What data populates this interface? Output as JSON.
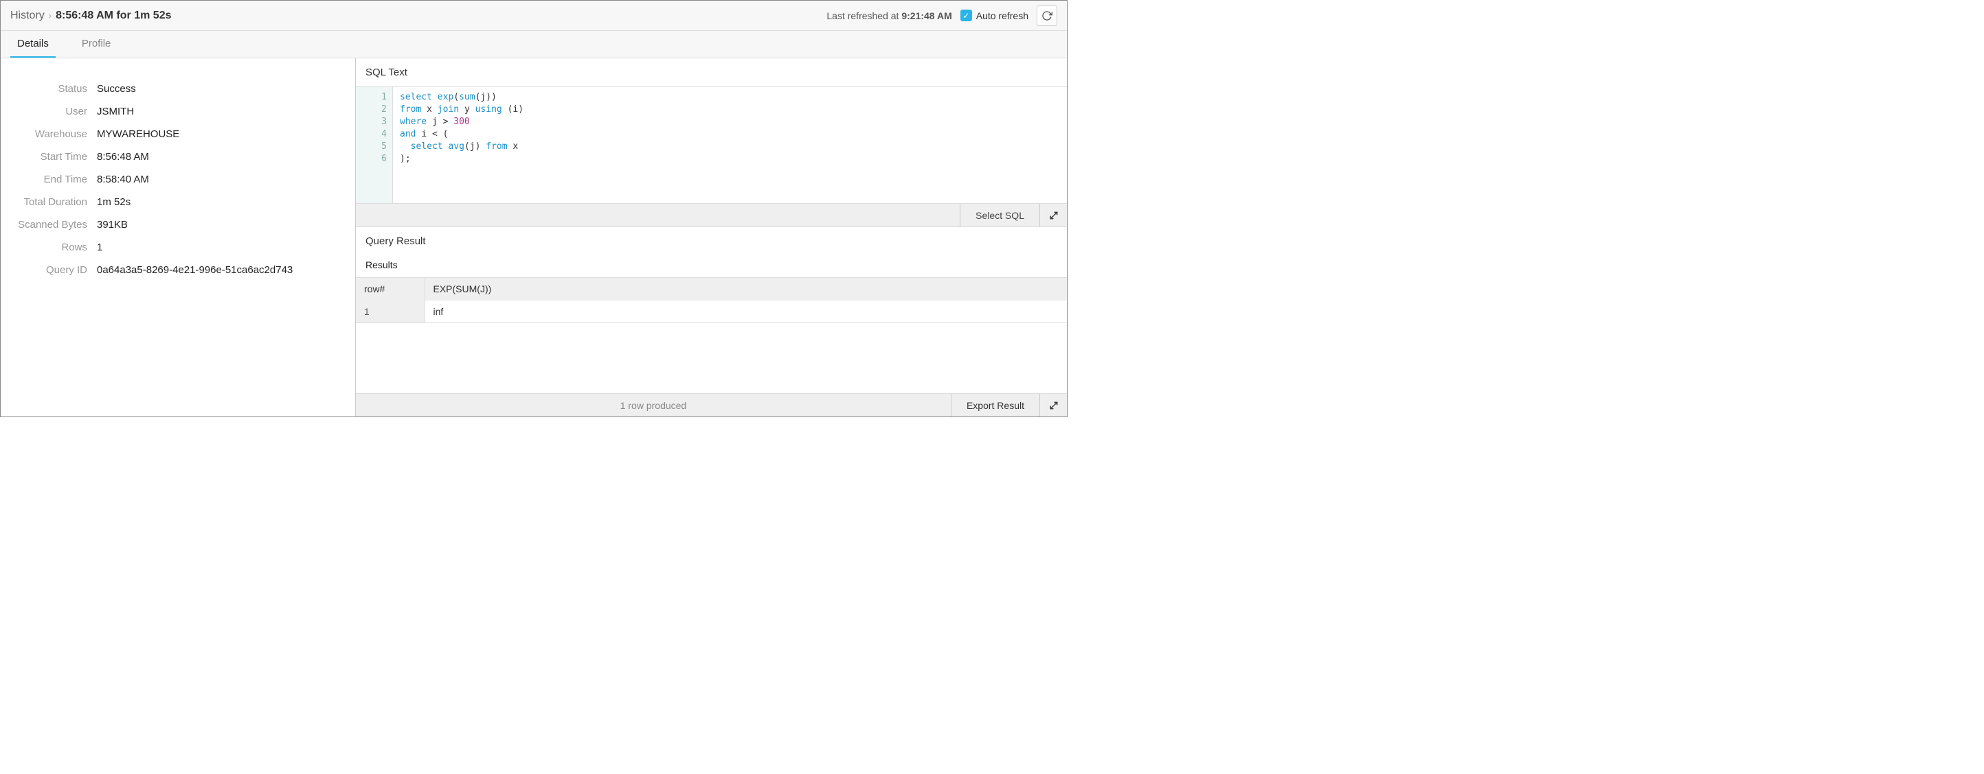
{
  "header": {
    "breadcrumb_root": "History",
    "breadcrumb_current": "8:56:48 AM for 1m 52s",
    "last_refreshed_label": "Last refreshed at",
    "last_refreshed_time": "9:21:48 AM",
    "autorefresh_label": "Auto refresh"
  },
  "tabs": {
    "details": "Details",
    "profile": "Profile"
  },
  "details": {
    "labels": {
      "status": "Status",
      "user": "User",
      "warehouse": "Warehouse",
      "start_time": "Start Time",
      "end_time": "End Time",
      "total_duration": "Total Duration",
      "scanned_bytes": "Scanned Bytes",
      "rows": "Rows",
      "query_id": "Query ID"
    },
    "values": {
      "status": "Success",
      "user": "JSMITH",
      "warehouse": "MYWAREHOUSE",
      "start_time": "8:56:48 AM",
      "end_time": "8:58:40 AM",
      "total_duration": "1m 52s",
      "scanned_bytes": "391KB",
      "rows": "1",
      "query_id": "0a64a3a5-8269-4e21-996e-51ca6ac2d743"
    }
  },
  "sql": {
    "title": "SQL Text",
    "line_numbers": [
      "1",
      "2",
      "3",
      "4",
      "5",
      "6"
    ],
    "tokens": [
      [
        [
          "kw",
          "select"
        ],
        [
          "sp",
          " "
        ],
        [
          "fn",
          "exp"
        ],
        [
          "id",
          "("
        ],
        [
          "fn",
          "sum"
        ],
        [
          "id",
          "(j))"
        ]
      ],
      [
        [
          "kw",
          "from"
        ],
        [
          "sp",
          " "
        ],
        [
          "id",
          "x "
        ],
        [
          "kw",
          "join"
        ],
        [
          "sp",
          " "
        ],
        [
          "id",
          "y "
        ],
        [
          "kw",
          "using"
        ],
        [
          "sp",
          " "
        ],
        [
          "id",
          "(i)"
        ]
      ],
      [
        [
          "kw",
          "where"
        ],
        [
          "sp",
          " "
        ],
        [
          "id",
          "j > "
        ],
        [
          "num",
          "300"
        ]
      ],
      [
        [
          "kw",
          "and"
        ],
        [
          "sp",
          " "
        ],
        [
          "id",
          "i < ("
        ]
      ],
      [
        [
          "sp",
          "  "
        ],
        [
          "kw",
          "select"
        ],
        [
          "sp",
          " "
        ],
        [
          "fn",
          "avg"
        ],
        [
          "id",
          "(j) "
        ],
        [
          "kw",
          "from"
        ],
        [
          "sp",
          " "
        ],
        [
          "id",
          "x"
        ]
      ],
      [
        [
          "id",
          ");"
        ]
      ]
    ],
    "select_button": "Select SQL"
  },
  "result": {
    "title": "Query Result",
    "results_label": "Results",
    "columns": [
      "row#",
      "EXP(SUM(J))"
    ],
    "rows": [
      [
        "1",
        "inf"
      ]
    ],
    "footer_status": "1 row produced",
    "export_button": "Export Result"
  }
}
